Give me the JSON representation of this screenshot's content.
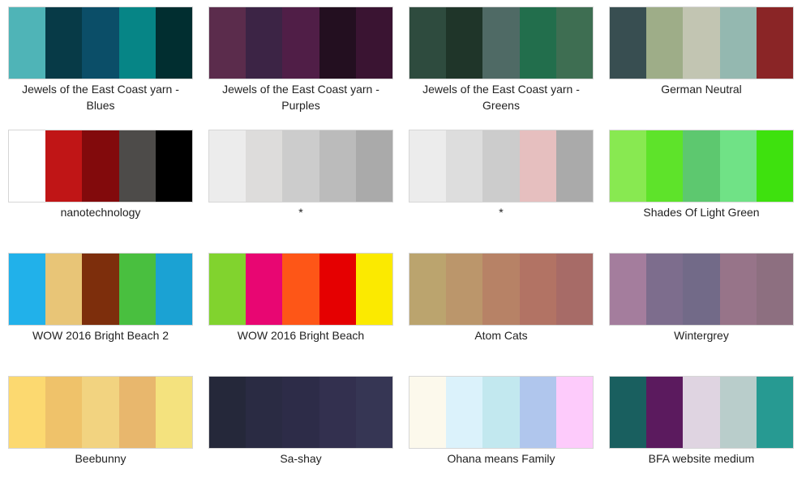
{
  "palettes": [
    {
      "name": "Jewels of the East Coast yarn - Blues",
      "colors": [
        "#4fb4b7",
        "#073a47",
        "#0b4e68",
        "#068586",
        "#012e30"
      ]
    },
    {
      "name": "Jewels of the East Coast yarn - Purples",
      "colors": [
        "#5b2c4c",
        "#3c2445",
        "#501e47",
        "#230f20",
        "#3a1432"
      ]
    },
    {
      "name": "Jewels of the East Coast yarn - Greens",
      "colors": [
        "#2e4b3e",
        "#1f3529",
        "#4f6a65",
        "#226e4c",
        "#3e6e52"
      ]
    },
    {
      "name": "German Neutral",
      "colors": [
        "#384e51",
        "#9ead88",
        "#c2c5b2",
        "#94b8b0",
        "#8a2526"
      ]
    },
    {
      "name": "nanotechnology",
      "colors": [
        "#ffffff",
        "#c01516",
        "#820a0c",
        "#4d4b49",
        "#000000"
      ]
    },
    {
      "name": "*",
      "colors": [
        "#ececec",
        "#dddcdb",
        "#cccccc",
        "#bbbbbb",
        "#aaaaaa"
      ]
    },
    {
      "name": "*",
      "colors": [
        "#ececec",
        "#dddddd",
        "#cccccc",
        "#e6bfbf",
        "#aaaaaa"
      ]
    },
    {
      "name": "Shades Of Light Green",
      "colors": [
        "#88e951",
        "#5ee32a",
        "#5dc86f",
        "#70e286",
        "#3ee10e"
      ]
    },
    {
      "name": "WOW 2016 Bright Beach 2",
      "colors": [
        "#21b1ea",
        "#e8c577",
        "#7d2e0c",
        "#49bf3f",
        "#1ba2d3"
      ]
    },
    {
      "name": "WOW 2016 Bright Beach",
      "colors": [
        "#81d32e",
        "#e80672",
        "#fe5617",
        "#e50001",
        "#fbea00"
      ]
    },
    {
      "name": "Atom Cats",
      "colors": [
        "#bba46e",
        "#bb966b",
        "#b78266",
        "#b27364",
        "#a76b67"
      ]
    },
    {
      "name": "Wintergrey",
      "colors": [
        "#a47d9d",
        "#7d6d8d",
        "#726a88",
        "#977489",
        "#8d6f80"
      ]
    },
    {
      "name": "Beebunny",
      "colors": [
        "#fcd970",
        "#efc26a",
        "#f2d380",
        "#e8b76d",
        "#f4e27e"
      ]
    },
    {
      "name": "Sa-shay",
      "colors": [
        "#25283a",
        "#2a2b43",
        "#2d2c48",
        "#33304f",
        "#363654"
      ]
    },
    {
      "name": "Ohana means Family",
      "colors": [
        "#fcf9ec",
        "#dbf2fb",
        "#c2e8ef",
        "#b0c6ed",
        "#fdcbfb"
      ]
    },
    {
      "name": "BFA website medium",
      "colors": [
        "#195f5f",
        "#5b1a5e",
        "#dfd4e1",
        "#b9cdcb",
        "#279a92"
      ]
    }
  ]
}
